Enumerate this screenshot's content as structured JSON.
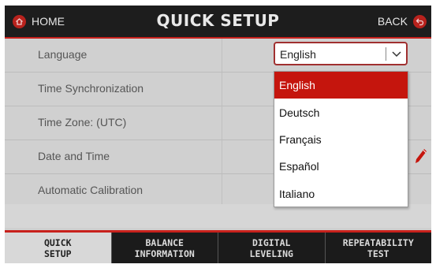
{
  "header": {
    "home_label": "HOME",
    "title": "QUICK SETUP",
    "back_label": "BACK"
  },
  "settings": [
    {
      "label": "Language"
    },
    {
      "label": "Time Synchronization"
    },
    {
      "label": "Time Zone: (UTC)"
    },
    {
      "label": "Date and Time"
    },
    {
      "label": "Automatic Calibration"
    }
  ],
  "language_select": {
    "value": "English",
    "options": [
      "English",
      "Deutsch",
      "Français",
      "Español",
      "Italiano"
    ],
    "selected_index": 0
  },
  "tabs": [
    {
      "label": "QUICK\nSETUP",
      "active": true
    },
    {
      "label": "BALANCE\nINFORMATION",
      "active": false
    },
    {
      "label": "DIGITAL\nLEVELING",
      "active": false
    },
    {
      "label": "REPEATABILITY\nTEST",
      "active": false
    }
  ],
  "colors": {
    "accent_red": "#c5150d",
    "header_bg": "#1d1d1d",
    "list_bg": "#d0d0d0"
  },
  "icons": {
    "home": "home-icon",
    "back": "back-arrow-icon",
    "dropdown": "chevron-down-icon",
    "edit": "pencil-icon"
  }
}
